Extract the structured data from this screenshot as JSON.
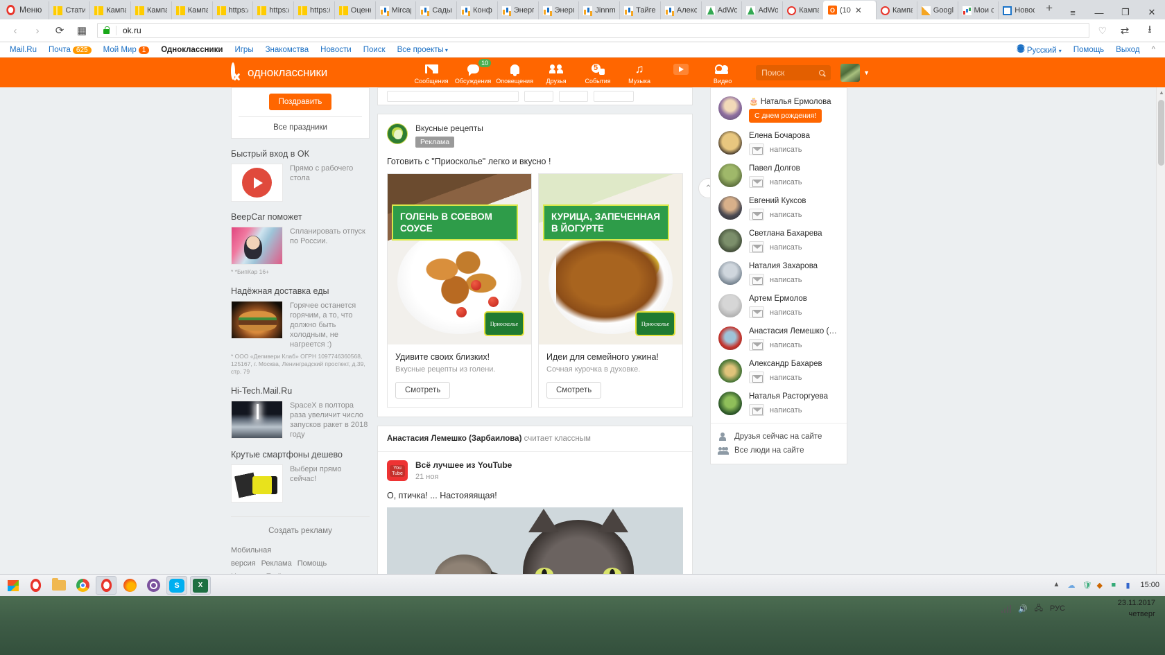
{
  "browser": {
    "menu_label": "Меню",
    "tabs": [
      {
        "label": "Стати",
        "icon": "chart-favicon",
        "active": false
      },
      {
        "label": "Кампа",
        "icon": "chart-favicon",
        "active": false
      },
      {
        "label": "Кампа",
        "icon": "chart-favicon",
        "active": false
      },
      {
        "label": "Кампа",
        "icon": "chart-favicon",
        "active": false
      },
      {
        "label": "https:/",
        "icon": "chart-favicon",
        "active": false
      },
      {
        "label": "https:/",
        "icon": "chart-favicon",
        "active": false
      },
      {
        "label": "https:/",
        "icon": "chart-favicon",
        "active": false
      },
      {
        "label": "Оценк",
        "icon": "chart-favicon",
        "active": false
      },
      {
        "label": "Mircap",
        "icon": "bars-favicon",
        "active": false
      },
      {
        "label": "Сады",
        "icon": "bars-favicon",
        "active": false
      },
      {
        "label": "Конф",
        "icon": "bars-favicon",
        "active": false
      },
      {
        "label": "Энерг",
        "icon": "bars-favicon",
        "active": false
      },
      {
        "label": "Энерг",
        "icon": "bars-favicon",
        "active": false
      },
      {
        "label": "Jinnm",
        "icon": "bars-favicon",
        "active": false
      },
      {
        "label": "Тайгер",
        "icon": "bars-favicon",
        "active": false
      },
      {
        "label": "Алекс",
        "icon": "bars-favicon",
        "active": false
      },
      {
        "label": "AdWo",
        "icon": "adwords-favicon",
        "active": false
      },
      {
        "label": "AdWo",
        "icon": "adwords-favicon",
        "active": false
      },
      {
        "label": "Кампа",
        "icon": "ads-favicon",
        "active": false
      },
      {
        "label": "(10",
        "icon": "odnoklassniki-favicon",
        "active": true
      },
      {
        "label": "Кампа",
        "icon": "ads-favicon",
        "active": false
      },
      {
        "label": "Googl",
        "icon": "analytics-favicon",
        "active": false
      },
      {
        "label": "Мои с",
        "icon": "mybars-favicon",
        "active": false
      },
      {
        "label": "Новос",
        "icon": "news-favicon",
        "active": false
      }
    ],
    "new_tab_label": "+",
    "url": "ok.ru",
    "window_controls": [
      "—",
      "❐",
      "✕"
    ],
    "tab_list_glyph": "≡"
  },
  "toplinks": {
    "items": [
      {
        "label": "Mail.Ru",
        "badge": null,
        "bold": false
      },
      {
        "label": "Почта",
        "badge": "625",
        "bold": false
      },
      {
        "label": "Мой Мир",
        "badge": "1",
        "bold": false
      },
      {
        "label": "Одноклассники",
        "badge": null,
        "bold": true
      },
      {
        "label": "Игры",
        "badge": null,
        "bold": false
      },
      {
        "label": "Знакомства",
        "badge": null,
        "bold": false
      },
      {
        "label": "Новости",
        "badge": null,
        "bold": false
      },
      {
        "label": "Поиск",
        "badge": null,
        "bold": false
      },
      {
        "label": "Все проекты",
        "badge": null,
        "bold": false
      }
    ],
    "right": {
      "language": "Русский",
      "help": "Помощь",
      "logout": "Выход",
      "collapse": "^"
    }
  },
  "ok_header": {
    "brand": "одноклассники",
    "nav": [
      {
        "label": "Сообщения",
        "icon": "envelope-icon",
        "badge": null
      },
      {
        "label": "Обсуждения",
        "icon": "speech-bubble-icon",
        "badge": "10"
      },
      {
        "label": "Оповещения",
        "icon": "bell-icon",
        "badge": null
      },
      {
        "label": "Друзья",
        "icon": "friends-icon",
        "badge": null
      },
      {
        "label": "События",
        "icon": "events-icon",
        "badge": null
      },
      {
        "label": "Музыка",
        "icon": "music-note-icon",
        "badge": null
      },
      {
        "label": "",
        "icon": "play-icon",
        "badge": null
      },
      {
        "label": "Видео",
        "icon": "video-camera-icon",
        "badge": null
      }
    ],
    "search_placeholder": "Поиск",
    "search_value": "",
    "accent_color": "#ff6600"
  },
  "left_column": {
    "congratulate_button": "Поздравить",
    "all_holidays": "Все праздники",
    "ads": [
      {
        "title": "Быстрый вход в ОК",
        "text": "Прямо с рабочего стола",
        "thumb": "arrow-badge-thumb",
        "disclaimer": null
      },
      {
        "title": "BeepCar поможет",
        "text": "Спланировать отпуск по России.",
        "thumb": "car-woman-thumb",
        "disclaimer": "* *БипКар 16+"
      },
      {
        "title": "Надёжная доставка еды",
        "text": "Горячее останется горячим, а то, что должно быть холодным, не нагреется :)",
        "thumb": "burger-thumb",
        "disclaimer": "* ООО «Деливери Клаб» ОГРН 1097746360568, 125167, г. Москва, Ленинградский проспект, д.39, стр. 79"
      },
      {
        "title": "Hi-Tech.Mail.Ru",
        "text": "SpaceX в полтора раза увеличит число запусков ракет в 2018 году",
        "thumb": "rocket-launch-thumb",
        "disclaimer": null
      },
      {
        "title": "Крутые смартфоны дешево",
        "text": "Выбери прямо сейчас!",
        "thumb": "smartphone-thumb",
        "disclaimer": null
      }
    ],
    "create_ad": "Создать рекламу",
    "footer_links": [
      "Мобильная версия",
      "Реклама",
      "Помощь",
      "Новости",
      "Ещё"
    ]
  },
  "feed": {
    "ad_post": {
      "group_name": "Вкусные рецепты",
      "badge": "Реклама",
      "text": "Готовить с \"Приосколье\" легко и вкусно !",
      "cards": [
        {
          "banner_label": "ГОЛЕНЬ В СОЕВОМ СОУСЕ",
          "title": "Удивите своих близких!",
          "subtitle": "Вкусные рецепты из голени.",
          "button": "Смотреть",
          "brand_logo": "Приосколье"
        },
        {
          "banner_label": "КУРИЦА, ЗАПЕЧЕННАЯ В ЙОГУРТЕ",
          "title": "Идеи для семейного ужина!",
          "subtitle": "Сочная курочка в духовке.",
          "button": "Смотреть",
          "brand_logo": "Приосколье"
        }
      ]
    },
    "share_post": {
      "sharer": "Анастасия Лемешко (Зарбаилова)",
      "share_action": "считает классным",
      "group_name": "Всё лучшее из YouTube",
      "date": "21 ноя",
      "text": "О, птичка! ... Настояяящая!"
    },
    "scroll_top_glyph": "⌃"
  },
  "right_column": {
    "friends": [
      {
        "name": "Наталья Ермолова",
        "has_birthday": true,
        "action": "С днем рождения!",
        "action_type": "button"
      },
      {
        "name": "Елена Бочарова",
        "has_birthday": false,
        "action": "написать",
        "action_type": "link"
      },
      {
        "name": "Павел Долгов",
        "has_birthday": false,
        "action": "написать",
        "action_type": "link"
      },
      {
        "name": "Евгений Куксов",
        "has_birthday": false,
        "action": "написать",
        "action_type": "link"
      },
      {
        "name": "Светлана Бахарева",
        "has_birthday": false,
        "action": "написать",
        "action_type": "link"
      },
      {
        "name": "Наталия Захарова",
        "has_birthday": false,
        "action": "написать",
        "action_type": "link"
      },
      {
        "name": "Артем Ермолов",
        "has_birthday": false,
        "action": "написать",
        "action_type": "link"
      },
      {
        "name": "Анастасия Лемешко (За...",
        "has_birthday": false,
        "action": "написать",
        "action_type": "link"
      },
      {
        "name": "Александр Бахарев",
        "has_birthday": false,
        "action": "написать",
        "action_type": "link"
      },
      {
        "name": "Наталья Расторгуева",
        "has_birthday": false,
        "action": "написать",
        "action_type": "link"
      }
    ],
    "footer": [
      {
        "label": "Друзья сейчас на сайте",
        "icon": "single-person-icon"
      },
      {
        "label": "Все люди на сайте",
        "icon": "group-people-icon"
      }
    ]
  },
  "taskbar": {
    "apps": [
      {
        "name": "opera",
        "active": false
      },
      {
        "name": "explorer",
        "active": false
      },
      {
        "name": "chrome",
        "active": false
      },
      {
        "name": "opera",
        "active": true
      },
      {
        "name": "firefox",
        "active": false
      },
      {
        "name": "viber",
        "active": false
      },
      {
        "name": "skype",
        "label": "S",
        "active": true
      },
      {
        "name": "excel",
        "label": "X",
        "active": true
      }
    ],
    "language": "РУС",
    "time": "15:00",
    "date": "23.11.2017",
    "weekday": "четверг"
  }
}
